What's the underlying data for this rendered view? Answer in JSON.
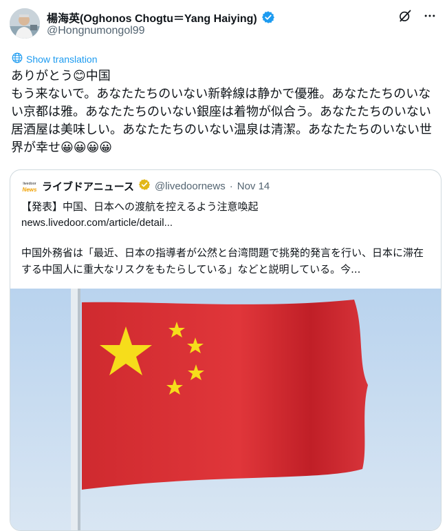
{
  "author": {
    "display_name": "楊海英(Oghonos Chogtu＝Yang Haiying)",
    "handle": "@Hongnumongol99"
  },
  "icons": {
    "verified": "verified-badge-icon",
    "grok": "grok-icon",
    "more": "more-icon",
    "translate": "translate-icon"
  },
  "translate_label": "Show translation",
  "tweet": {
    "text": "ありがとう😊中国\nもう来ないで。あなたたちのいない新幹線は静かで優雅。あなたたちのいない京都は雅。あなたたちのいない銀座は着物が似合う。あなたたちのいない居酒屋は美味しい。あなたたちのいない温泉は清潔。あなたたちのいない世界が幸せ😀😀😀😀"
  },
  "quote": {
    "logo_top": "livedoor",
    "logo_bottom": "News",
    "name": "ライブドアニュース",
    "handle": "@livedoornews",
    "separator": "·",
    "date": "Nov 14",
    "title": "【発表】中国、日本への渡航を控えるよう注意喚起",
    "link": "news.livedoor.com/article/detail...",
    "body": "中国外務省は「最近、日本の指導者が公然と台湾問題で挑発的発言を行い、日本に滞在する中国人に重大なリスクをもたらしている」などと説明している。今..."
  },
  "colors": {
    "accent": "#1d9bf0",
    "flag_red": "#d8282f",
    "flag_star": "#f6dd1b",
    "gold_badge": "#e2b719"
  }
}
